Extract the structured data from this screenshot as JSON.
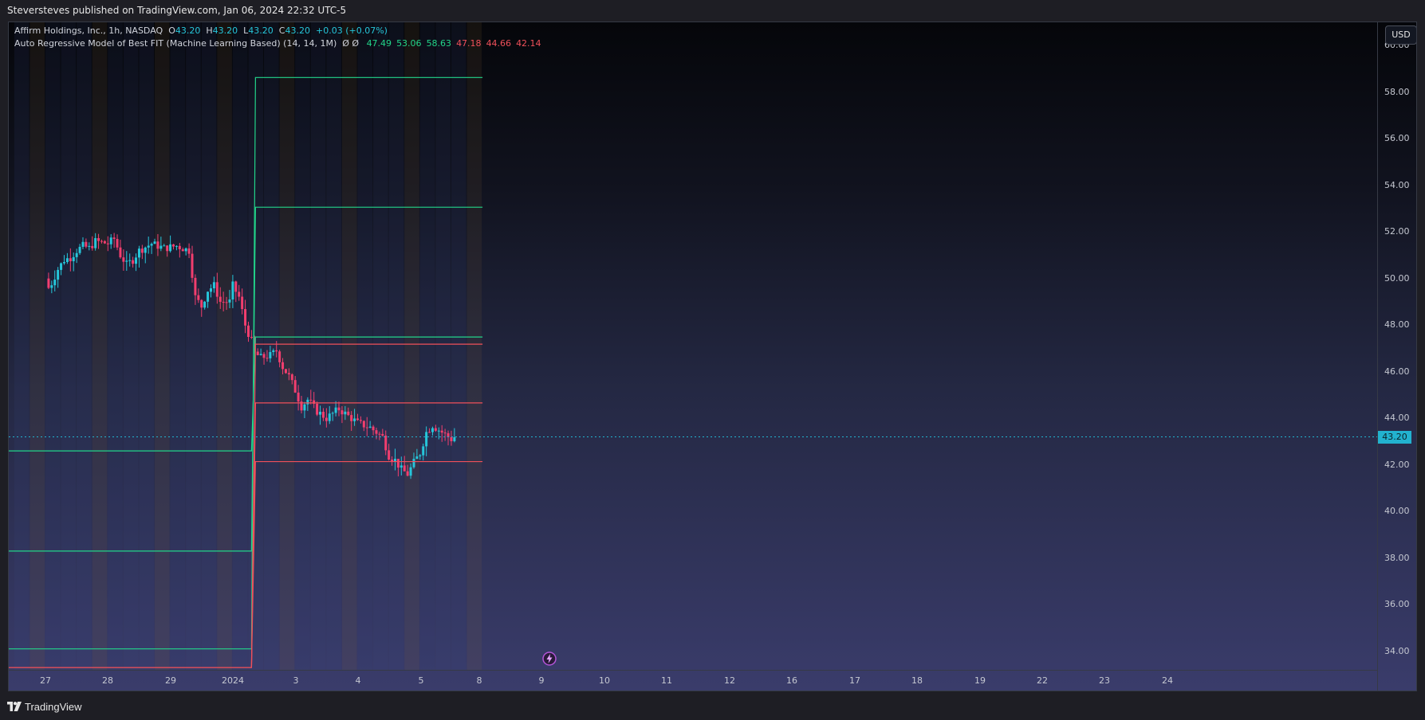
{
  "header": {
    "published_by": "Steversteves published on TradingView.com, Jan 06, 2024 22:32 UTC-5"
  },
  "legend": {
    "symbol": "Affirm Holdings, Inc., 1h, NASDAQ",
    "o_label": "O",
    "o_value": "43.20",
    "h_label": "H",
    "h_value": "43.20",
    "l_label": "L",
    "l_value": "43.20",
    "c_label": "C",
    "c_value": "43.20",
    "change": "+0.03 (+0.07%)",
    "indicator_name": "Auto Regressive Model of Best FIT (Machine Learning Based) (14, 14, 1M)",
    "indicator_flags": "Ø Ø",
    "indicator_values": [
      {
        "text": "47.49",
        "color": "#22d58a"
      },
      {
        "text": "53.06",
        "color": "#22d58a"
      },
      {
        "text": "58.63",
        "color": "#22d58a"
      },
      {
        "text": "47.18",
        "color": "#f0505a"
      },
      {
        "text": "44.66",
        "color": "#f0505a"
      },
      {
        "text": "42.14",
        "color": "#f0505a"
      }
    ]
  },
  "currency": "USD",
  "last_price": "43.20",
  "price_axis": [
    "60.00",
    "58.00",
    "56.00",
    "54.00",
    "52.00",
    "50.00",
    "48.00",
    "46.00",
    "44.00",
    "42.00",
    "40.00",
    "38.00",
    "36.00",
    "34.00"
  ],
  "time_axis": [
    {
      "label": "27",
      "i": 0
    },
    {
      "label": "28",
      "i": 1
    },
    {
      "label": "29",
      "i": 2
    },
    {
      "label": "2024",
      "i": 3
    },
    {
      "label": "3",
      "i": 4
    },
    {
      "label": "4",
      "i": 5
    },
    {
      "label": "5",
      "i": 6
    },
    {
      "label": "8",
      "i": 7
    },
    {
      "label": "9",
      "i": 8
    },
    {
      "label": "10",
      "i": 9
    },
    {
      "label": "11",
      "i": 10
    },
    {
      "label": "12",
      "i": 11
    },
    {
      "label": "16",
      "i": 12
    },
    {
      "label": "17",
      "i": 13
    },
    {
      "label": "18",
      "i": 14
    },
    {
      "label": "19",
      "i": 15
    },
    {
      "label": "22",
      "i": 16
    },
    {
      "label": "23",
      "i": 17
    },
    {
      "label": "24",
      "i": 18
    }
  ],
  "footer": {
    "brand": "TradingView"
  },
  "colors": {
    "bull": "#26c6da",
    "bear": "#f23e6e",
    "upper_band": "#22d58a",
    "lower_band": "#f0505a",
    "last_price_line": "#22b2cf"
  },
  "chart_data": {
    "type": "candlestick",
    "symbol": "AFRM",
    "interval": "1h",
    "ylim": [
      33.2,
      61.0
    ],
    "candles_close_path": [
      [
        0,
        50.0
      ],
      [
        0.05,
        49.6
      ],
      [
        0.1,
        49.8
      ],
      [
        0.2,
        50.4
      ],
      [
        0.3,
        50.8
      ],
      [
        0.4,
        50.9
      ],
      [
        0.5,
        51.2
      ],
      [
        0.6,
        51.4
      ],
      [
        0.7,
        51.3
      ],
      [
        0.8,
        51.6
      ],
      [
        1.0,
        51.5
      ],
      [
        1.1,
        51.7
      ],
      [
        1.2,
        51.0
      ],
      [
        1.3,
        50.6
      ],
      [
        1.4,
        50.8
      ],
      [
        1.5,
        51.2
      ],
      [
        1.7,
        51.5
      ],
      [
        1.9,
        51.3
      ],
      [
        2.1,
        51.4
      ],
      [
        2.3,
        51.2
      ],
      [
        2.4,
        49.2
      ],
      [
        2.5,
        48.8
      ],
      [
        2.6,
        49.5
      ],
      [
        2.7,
        49.7
      ],
      [
        2.8,
        49.0
      ],
      [
        2.95,
        49.0
      ],
      [
        3.0,
        49.7
      ],
      [
        3.1,
        49.2
      ],
      [
        3.2,
        48.0
      ],
      [
        3.3,
        47.3
      ],
      [
        3.35,
        46.8
      ],
      [
        3.45,
        46.6
      ],
      [
        3.6,
        46.7
      ],
      [
        3.7,
        46.9
      ],
      [
        3.8,
        46.2
      ],
      [
        3.9,
        45.8
      ],
      [
        4.0,
        45.2
      ],
      [
        4.1,
        44.5
      ],
      [
        4.2,
        44.8
      ],
      [
        4.35,
        44.3
      ],
      [
        4.5,
        44.0
      ],
      [
        4.6,
        44.2
      ],
      [
        4.7,
        44.4
      ],
      [
        4.8,
        44.2
      ],
      [
        5.0,
        43.8
      ],
      [
        5.2,
        43.6
      ],
      [
        5.4,
        43.2
      ],
      [
        5.5,
        42.4
      ],
      [
        5.6,
        42.2
      ],
      [
        5.7,
        41.8
      ],
      [
        5.8,
        41.6
      ],
      [
        5.9,
        42.1
      ],
      [
        6.0,
        42.5
      ],
      [
        6.1,
        43.4
      ],
      [
        6.2,
        43.7
      ],
      [
        6.3,
        43.5
      ],
      [
        6.4,
        43.3
      ],
      [
        6.5,
        43.1
      ],
      [
        6.55,
        43.2
      ]
    ],
    "indicator": {
      "name": "Auto Regressive Model of Best FIT (Machine Learning Based)",
      "params": [
        14,
        14,
        "1M"
      ],
      "prior_upper_bands": [
        42.6,
        38.3,
        34.1
      ],
      "prior_lower_bands": [
        33.3
      ],
      "current_upper_bands": [
        47.49,
        53.06,
        58.63
      ],
      "current_lower_bands": [
        47.18,
        44.66,
        42.14
      ]
    },
    "last_price": 43.2
  }
}
